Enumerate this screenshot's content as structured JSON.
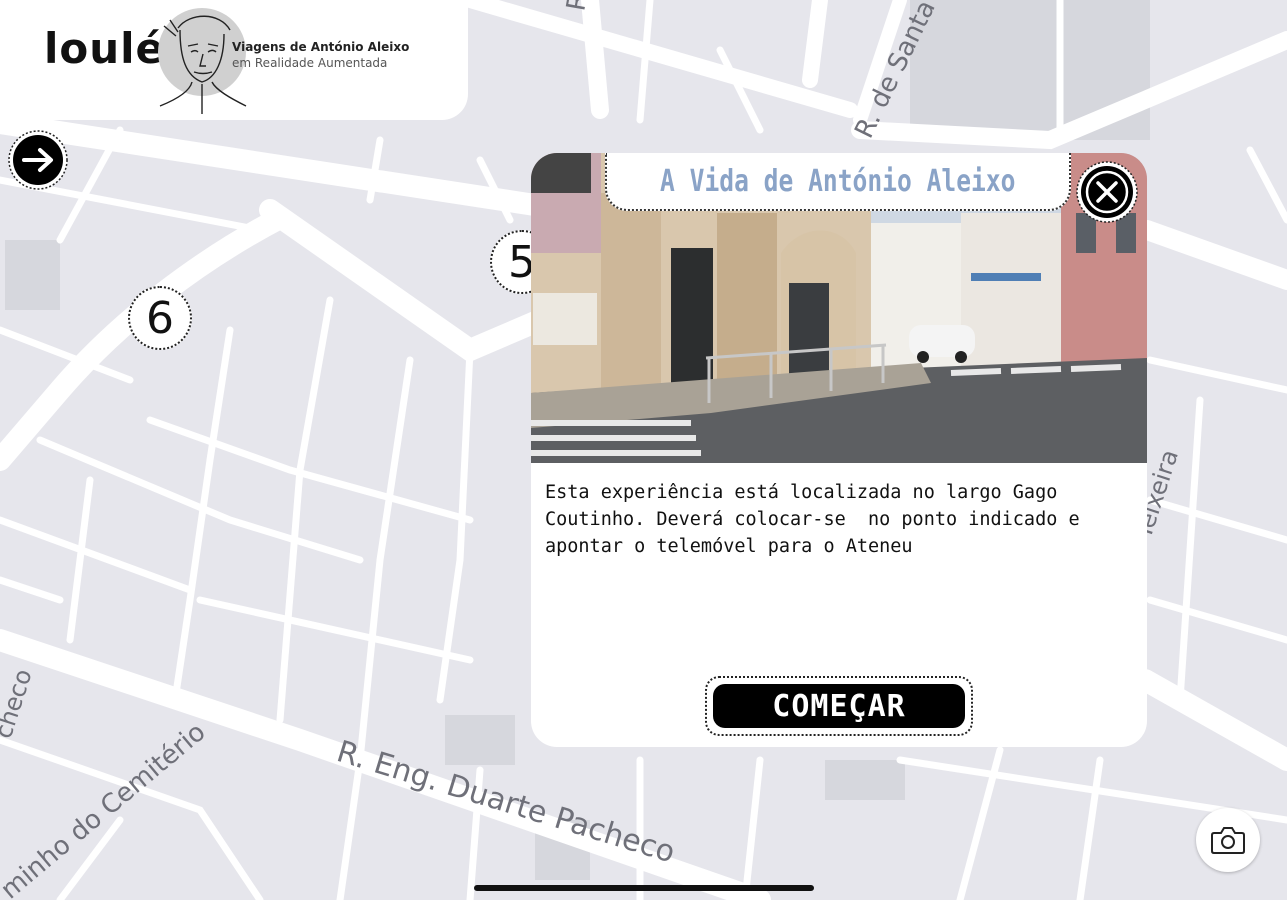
{
  "header": {
    "brand": "loulé",
    "subtitle_line1": "Viagens de António Aleixo",
    "subtitle_line2": "em Realidade Aumentada"
  },
  "map": {
    "streets": {
      "top_left": "R.",
      "r_de_santa": "R. de Santa",
      "feixeira": "Teixeira",
      "eco": "checo",
      "cemiterio": "minho do Cemitério",
      "duarte_pacheco": "R. Eng. Duarte Pacheco"
    },
    "markers": {
      "six": "6",
      "five": "5"
    }
  },
  "popup": {
    "title": "A Vida de António Aleixo",
    "description": "Esta experiência está localizada no largo Gago\nCoutinho. Deverá colocar-se  no ponto indicado e\napontar o telemóvel para o Ateneu",
    "start_label": "COMEÇAR"
  },
  "icons": {
    "next": "arrow-right-icon",
    "close": "close-icon",
    "camera": "camera-icon"
  },
  "colors": {
    "map_background": "#e6e6ec",
    "road": "#ffffff",
    "title_accent": "#8aa3c7"
  }
}
